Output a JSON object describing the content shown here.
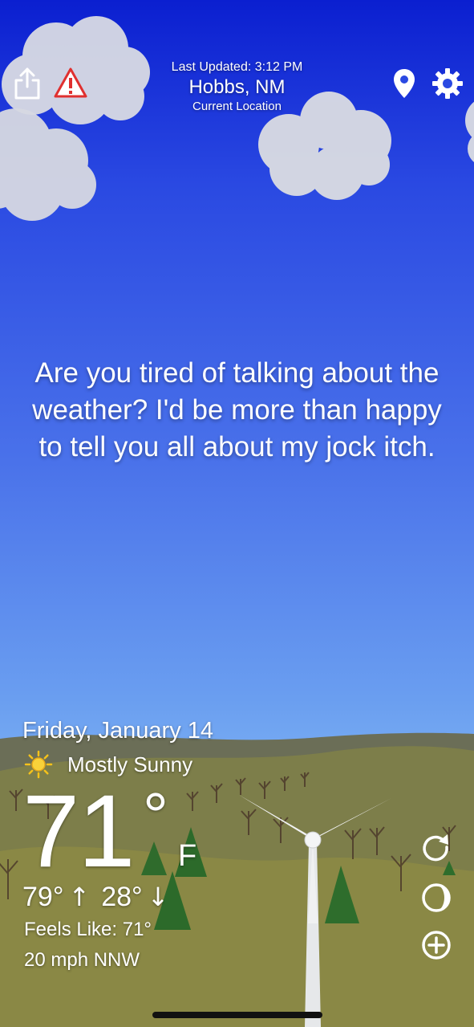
{
  "header": {
    "last_updated": "Last Updated: 3:12 PM",
    "city": "Hobbs, NM",
    "location_subtitle": "Current Location"
  },
  "toolbar": {
    "share_icon": "share-icon",
    "alert_icon": "warning-triangle-icon",
    "location_icon": "location-pin-icon",
    "settings_icon": "gear-icon"
  },
  "message": "Are you tired of talking about the weather? I'd be more than happy to tell you all about my jock itch.",
  "weather": {
    "date": "Friday, January 14",
    "condition": "Mostly Sunny",
    "condition_icon": "sun-icon",
    "temperature": "71",
    "degree_symbol": "°",
    "unit": "F",
    "high": "79°",
    "low": "28°",
    "feels_like": "Feels Like: 71°",
    "wind": "20 mph NNW"
  },
  "side_actions": {
    "refresh_icon": "refresh-icon",
    "moon_icon": "moon-phase-icon",
    "add_icon": "add-circle-icon"
  },
  "colors": {
    "sky_top": "#0b1fd0",
    "sky_bottom": "#8bbdf3",
    "hills": "#8a8845",
    "alert_red": "#e0302f"
  }
}
